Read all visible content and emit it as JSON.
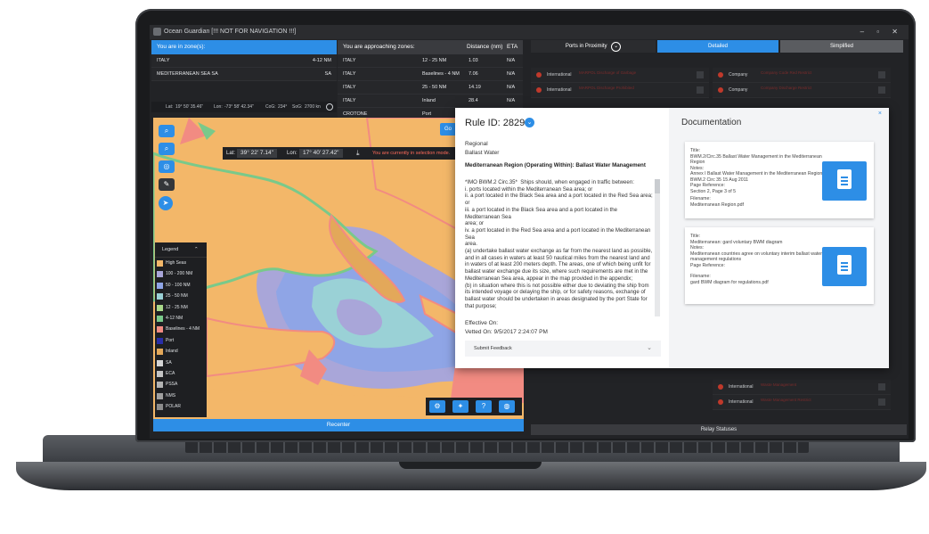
{
  "window": {
    "title": "Ocean Guardian [!!! NOT FOR NAVIGATION !!!]",
    "controls": "–  ▫  ✕"
  },
  "zones_in": {
    "header": "You are in zone(s):",
    "rows": [
      {
        "name": "ITALY",
        "value": "4-12 NM"
      },
      {
        "name": "MEDITERRANEAN SEA SA",
        "value": "SA"
      }
    ]
  },
  "zones_approaching": {
    "header": "You are approaching zones:",
    "distance_header": "Distance (nm)",
    "eta_header": "ETA",
    "rows": [
      {
        "name": "ITALY",
        "zone": "12 - 25 NM",
        "distance": "1.03",
        "eta": "N/A"
      },
      {
        "name": "ITALY",
        "zone": "Baselines - 4 NM",
        "distance": "7.06",
        "eta": "N/A"
      },
      {
        "name": "ITALY",
        "zone": "25 - 50 NM",
        "distance": "14.19",
        "eta": "N/A"
      },
      {
        "name": "ITALY",
        "zone": "Inland",
        "distance": "28.4",
        "eta": "N/A"
      },
      {
        "name": "CROTONE",
        "zone": "Port",
        "distance": "",
        "eta": ""
      }
    ]
  },
  "coords_strip": {
    "lat_label": "Lat:",
    "lat": "19° 50' 35.46\"",
    "lon_label": "Lon:",
    "lon": "-73° 58' 42.34\"",
    "cog_label": "CoG:",
    "cog": "234°",
    "sog_label": "SoG:",
    "sog": "2700 kn"
  },
  "map": {
    "lat_label": "Lat:",
    "lat_value": "39° 22' 7.14\"",
    "lon_label": "Lon:",
    "lon_value": "17° 40' 27.42\"",
    "selection_warning": "You are currently in selection mode.",
    "go_button": "Go",
    "recenter": "Recenter"
  },
  "legend": {
    "title": "Legend",
    "items": [
      {
        "label": "High Seas",
        "color": "#f3b769"
      },
      {
        "label": "100 - 200 NM",
        "color": "#a9a6d9"
      },
      {
        "label": "50 - 100 NM",
        "color": "#8fa5e6"
      },
      {
        "label": "25 - 50 NM",
        "color": "#9ad1d6"
      },
      {
        "label": "12 - 25 NM",
        "color": "#a9d98a"
      },
      {
        "label": "4-12 NM",
        "color": "#79c98a"
      },
      {
        "label": "Baselines - 4 NM",
        "color": "#f28b82"
      },
      {
        "label": "Port",
        "color": "#2a2ea8"
      },
      {
        "label": "Inland",
        "color": "#e3a85a"
      },
      {
        "label": "SA",
        "color": "#d5d5d5"
      },
      {
        "label": "ECA",
        "color": "#c4c4c4"
      },
      {
        "label": "PSSA",
        "color": "#b3b3b3"
      },
      {
        "label": "NMS",
        "color": "#a0a0a0"
      },
      {
        "label": "POLAR",
        "color": "#8c8c8c"
      }
    ]
  },
  "tabs": {
    "ports": "Ports in Proximity",
    "detailed": "Detailed",
    "simplified": "Simplified",
    "active_color": "#2d8ee6"
  },
  "right_list": {
    "left_rows": [
      {
        "label": "International",
        "desc": "MARPOL Discharge of Garbage"
      },
      {
        "label": "International",
        "desc": "MARPOL Discharge Prohibited"
      }
    ],
    "right_rows": [
      {
        "label": "Company",
        "desc": "Company Code Red Restrict"
      },
      {
        "label": "Company",
        "desc": "Company Discharge Restrict"
      }
    ],
    "bottom_rows": [
      {
        "label": "International",
        "desc": "Waste Management"
      },
      {
        "label": "International",
        "desc": "Waste Management Restrict"
      }
    ],
    "relay": "Relay Statuses"
  },
  "rule": {
    "title": "Rule ID: 2829",
    "scope": "Regional",
    "category": "Ballast Water",
    "region_line": "Mediterranean Region (Operating Within): Ballast Water Management",
    "body": "*IMO BWM.2 Circ.35*  Ships should, when engaged in traffic between:\ni. ports located within the Mediterranean Sea area; or\nii. a port located in the Black Sea area and a port located in the Red Sea area; or\niii. a port located in the Black Sea area and a port located in the Mediterranean Sea\narea; or\niv. a port located in the Red Sea area and a port located in the Mediterranean Sea\narea.\n(a) undertake ballast water exchange as far from the nearest land as possible, and in all cases in waters at least 50 nautical miles from the nearest land and in waters of at least 200 meters depth. The areas, one of which being unfit for ballast water exchange due its size, where such requirements are met in the Mediterranean Sea area, appear in the map provided in the appendix;\n(b) in situation where this is not possible either due to deviating the ship from its intended voyage or delaying the ship, or for safety reasons, exchange of ballast water should be undertaken in areas designated by the port State for that purpose;",
    "effective_label": "Effective On:",
    "vetted": "Vetted On: 9/5/2017 2:24:07 PM",
    "feedback": "Submit Feedback"
  },
  "documentation": {
    "title": "Documentation",
    "close": "×",
    "cards": [
      {
        "title_label": "Title:",
        "title": "BWM.2/Circ.35 Ballast Water Management in the Mediterranean Region",
        "notes_label": "Notes:",
        "notes": "Annex I Ballast Water Management in the Mediterranean Region BWM.2 Circ 35  15 Aug 2011",
        "page_label": "Page Reference:",
        "page": "Section 2, Page 3 of 5",
        "file_label": "Filename:",
        "file": "Mediterranean Region.pdf"
      },
      {
        "title_label": "Title:",
        "title": "Mediterranean: gard voluntary BWM diagram",
        "notes_label": "Notes:",
        "notes": "Mediterranean countries agree on voluntary interim ballast water management regulations",
        "page_label": "Page Reference:",
        "page": "",
        "file_label": "Filename:",
        "file": "gard BWM diagram for regulations.pdf"
      }
    ]
  }
}
